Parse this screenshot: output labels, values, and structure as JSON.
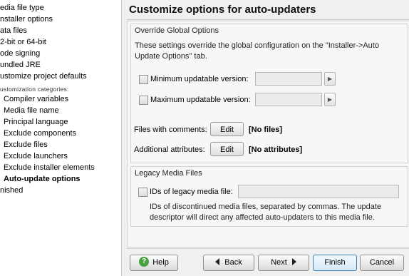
{
  "nav": {
    "items": [
      "edia file type",
      "nstaller options",
      "ata files",
      "2-bit or 64-bit",
      "ode signing",
      "undled JRE",
      "ustomize project defaults"
    ],
    "category_label": "ustomization categories:",
    "sub_items": [
      "Compiler variables",
      "Media file name",
      "Principal language",
      "Exclude components",
      "Exclude files",
      "Exclude launchers",
      "Exclude installer elements",
      "Auto-update options"
    ],
    "last_item": "nished"
  },
  "header": {
    "title": "Customize options for auto-updaters"
  },
  "override": {
    "group_title": "Override Global Options",
    "description_line1": "These settings override the global configuration on the \"Installer->Auto",
    "description_line2": "Update Options\" tab.",
    "min_label": "Minimum updatable version:",
    "max_label": "Maximum updatable version:",
    "min_value": "",
    "max_value": "",
    "files_comments_label": "Files with comments:",
    "files_comments_button": "Edit",
    "files_comments_value": "[No files]",
    "additional_attributes_label": "Additional attributes:",
    "additional_attributes_button": "Edit",
    "additional_attributes_value": "[No attributes]"
  },
  "legacy": {
    "group_title": "Legacy Media Files",
    "ids_label": "IDs of legacy media file:",
    "ids_value": "",
    "help_line1": "IDs of discontinued media files, separated by commas. The update",
    "help_line2": "descriptor will direct any affected auto-updaters to this media file."
  },
  "footer": {
    "help": "Help",
    "back": "Back",
    "next": "Next",
    "finish": "Finish",
    "cancel": "Cancel"
  },
  "colors": {
    "help_icon": "#47a23f",
    "finish_border": "#3c7fb1"
  },
  "icons": [
    "help-icon",
    "back-arrow-icon",
    "next-arrow-icon",
    "spinner-arrow-icon"
  ]
}
